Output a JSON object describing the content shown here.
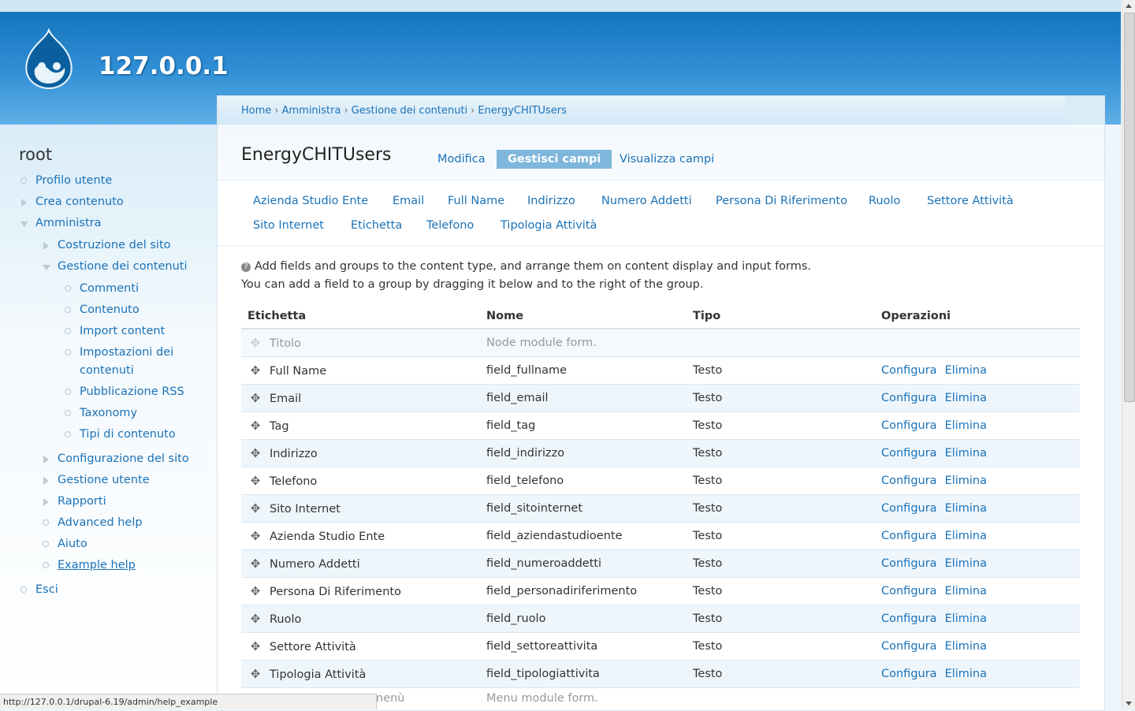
{
  "site": {
    "name": "127.0.0.1"
  },
  "sidebar": {
    "user": "root",
    "items": [
      {
        "label": "Profilo utente"
      },
      {
        "label": "Crea contenuto"
      },
      {
        "label": "Amministra"
      },
      {
        "label": "Costruzione del sito"
      },
      {
        "label": "Gestione dei contenuti"
      },
      {
        "label": "Commenti"
      },
      {
        "label": "Contenuto"
      },
      {
        "label": "Import content"
      },
      {
        "label": "Impostazioni dei"
      },
      {
        "label": "contenuti"
      },
      {
        "label": "Pubblicazione RSS"
      },
      {
        "label": "Taxonomy"
      },
      {
        "label": "Tipi di contenuto"
      },
      {
        "label": "Configurazione del sito"
      },
      {
        "label": "Gestione utente"
      },
      {
        "label": "Rapporti"
      },
      {
        "label": "Advanced help"
      },
      {
        "label": "Aiuto"
      },
      {
        "label": "Example help"
      },
      {
        "label": "Esci"
      }
    ]
  },
  "breadcrumb": [
    "Home",
    "Amministra",
    "Gestione dei contenuti",
    "EnergyCHITUsers"
  ],
  "page": {
    "title": "EnergyCHITUsers"
  },
  "tabs": [
    {
      "label": "Modifica"
    },
    {
      "label": "Gestisci campi"
    },
    {
      "label": "Visualizza campi"
    }
  ],
  "subtabs": [
    {
      "label": "Azienda Studio Ente"
    },
    {
      "label": "Email"
    },
    {
      "label": "Full Name"
    },
    {
      "label": "Indirizzo"
    },
    {
      "label": "Numero Addetti"
    },
    {
      "label": "Persona Di Riferimento"
    },
    {
      "label": "Ruolo"
    },
    {
      "label": "Settore Attività"
    },
    {
      "label": "Sito Internet"
    },
    {
      "label": "Etichetta"
    },
    {
      "label": "Telefono"
    },
    {
      "label": "Tipologia Attività"
    }
  ],
  "help": {
    "line1": "Add fields and groups to the content type, and arrange them on content display and input forms.",
    "line2": "You can add a field to a group by dragging it below and to the right of the group."
  },
  "table": {
    "headers": [
      "Etichetta",
      "Nome",
      "Tipo",
      "Operazioni"
    ],
    "rows": [
      {
        "label": "Titolo",
        "name": "Node module form.",
        "type": "",
        "configure": "",
        "delete": ""
      },
      {
        "label": "Full Name",
        "name": "field_fullname",
        "type": "Testo",
        "configure": "Configura",
        "delete": "Elimina"
      },
      {
        "label": "Email",
        "name": "field_email",
        "type": "Testo",
        "configure": "Configura",
        "delete": "Elimina"
      },
      {
        "label": "Tag",
        "name": "field_tag",
        "type": "Testo",
        "configure": "Configura",
        "delete": "Elimina"
      },
      {
        "label": "Indirizzo",
        "name": "field_indirizzo",
        "type": "Testo",
        "configure": "Configura",
        "delete": "Elimina"
      },
      {
        "label": "Telefono",
        "name": "field_telefono",
        "type": "Testo",
        "configure": "Configura",
        "delete": "Elimina"
      },
      {
        "label": "Sito Internet",
        "name": "field_sitointernet",
        "type": "Testo",
        "configure": "Configura",
        "delete": "Elimina"
      },
      {
        "label": "Azienda Studio Ente",
        "name": "field_aziendastudioente",
        "type": "Testo",
        "configure": "Configura",
        "delete": "Elimina"
      },
      {
        "label": "Numero Addetti",
        "name": "field_numeroaddetti",
        "type": "Testo",
        "configure": "Configura",
        "delete": "Elimina"
      },
      {
        "label": "Persona Di Riferimento",
        "name": "field_personadiriferimento",
        "type": "Testo",
        "configure": "Configura",
        "delete": "Elimina"
      },
      {
        "label": "Ruolo",
        "name": "field_ruolo",
        "type": "Testo",
        "configure": "Configura",
        "delete": "Elimina"
      },
      {
        "label": "Settore Attività",
        "name": "field_settoreattivita",
        "type": "Testo",
        "configure": "Configura",
        "delete": "Elimina"
      },
      {
        "label": "Tipologia Attività",
        "name": "field_tipologiattivita",
        "type": "Testo",
        "configure": "Configura",
        "delete": "Elimina"
      }
    ],
    "last_row": {
      "label": "nenù",
      "name": "Menu module form."
    }
  },
  "statusbar": {
    "url": "http://127.0.0.1/drupal-6.19/admin/help_example"
  },
  "colors": {
    "link": "#1a72b8",
    "header": "#1f7fc6",
    "active_tab": "#7fb7dc"
  }
}
